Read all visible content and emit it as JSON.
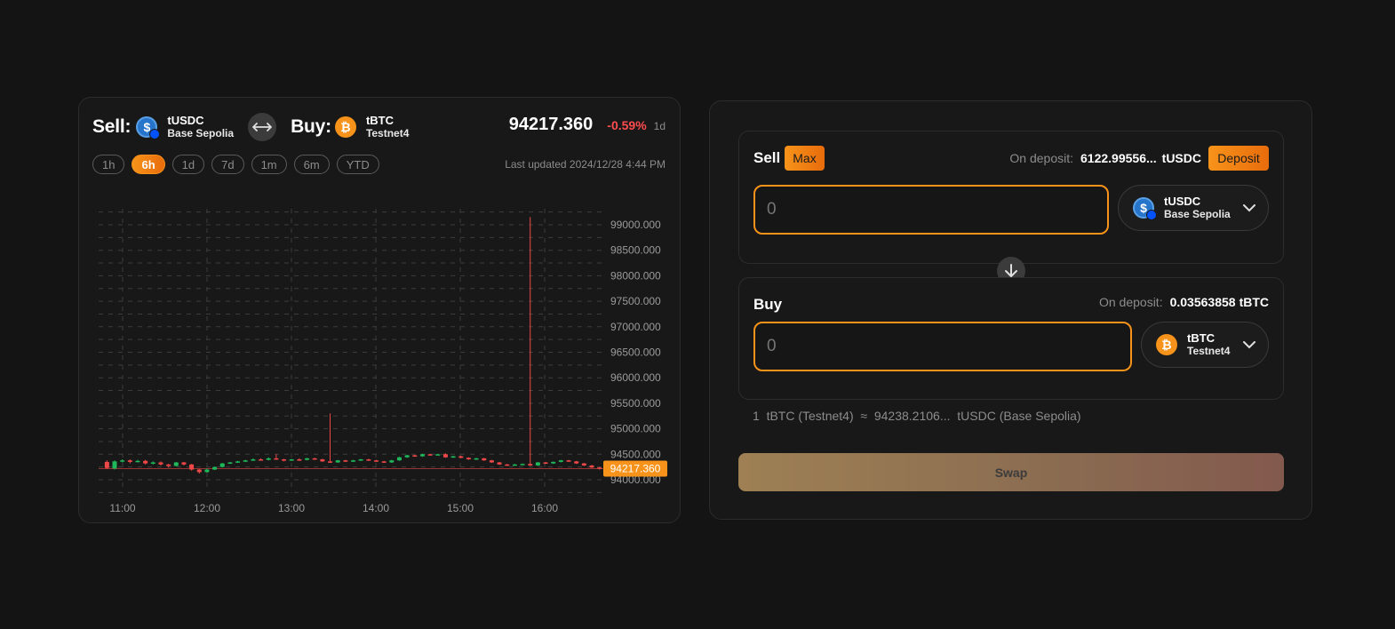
{
  "chart_header": {
    "sell_label": "Sell:",
    "buy_label": "Buy:",
    "sell_token": {
      "symbol": "tUSDC",
      "network": "Base Sepolia"
    },
    "buy_token": {
      "symbol": "tBTC",
      "network": "Testnet4"
    },
    "price": "94217.360",
    "change": "-0.59%",
    "period": "1d",
    "last_updated": "Last updated 2024/12/28 4:44 PM",
    "ranges": [
      "1h",
      "6h",
      "1d",
      "7d",
      "1m",
      "6m",
      "YTD"
    ],
    "active_range": "6h"
  },
  "chart_data": {
    "type": "candlestick",
    "x_ticks": [
      "11:00",
      "12:00",
      "13:00",
      "14:00",
      "15:00",
      "16:00"
    ],
    "y_ticks": [
      "99000.000",
      "98500.000",
      "98000.000",
      "97500.000",
      "97000.000",
      "96500.000",
      "96000.000",
      "95500.000",
      "95000.000",
      "94500.000",
      "94000.000"
    ],
    "ylim": [
      94000,
      99000
    ],
    "current_price_label": "94217.360",
    "current_price": 94217.36,
    "colors": {
      "up": "#1fb85a",
      "down": "#f04848",
      "grid": "#3c3c3c",
      "price_tag": "#f7931a"
    },
    "candles": [
      {
        "o": 94350,
        "c": 94230,
        "h": 94380,
        "l": 94210
      },
      {
        "o": 94220,
        "c": 94360,
        "h": 94380,
        "l": 94200
      },
      {
        "o": 94360,
        "c": 94380,
        "h": 94400,
        "l": 94340
      },
      {
        "o": 94380,
        "c": 94350,
        "h": 94400,
        "l": 94320
      },
      {
        "o": 94350,
        "c": 94370,
        "h": 94390,
        "l": 94340
      },
      {
        "o": 94370,
        "c": 94320,
        "h": 94390,
        "l": 94300
      },
      {
        "o": 94320,
        "c": 94340,
        "h": 94360,
        "l": 94300
      },
      {
        "o": 94340,
        "c": 94300,
        "h": 94360,
        "l": 94280
      },
      {
        "o": 94300,
        "c": 94270,
        "h": 94310,
        "l": 94240
      },
      {
        "o": 94270,
        "c": 94340,
        "h": 94350,
        "l": 94260
      },
      {
        "o": 94340,
        "c": 94300,
        "h": 94350,
        "l": 94280
      },
      {
        "o": 94300,
        "c": 94200,
        "h": 94310,
        "l": 94180
      },
      {
        "o": 94200,
        "c": 94150,
        "h": 94210,
        "l": 94120
      },
      {
        "o": 94150,
        "c": 94200,
        "h": 94220,
        "l": 94140
      },
      {
        "o": 94200,
        "c": 94250,
        "h": 94260,
        "l": 94190
      },
      {
        "o": 94250,
        "c": 94320,
        "h": 94330,
        "l": 94240
      },
      {
        "o": 94320,
        "c": 94340,
        "h": 94350,
        "l": 94310
      },
      {
        "o": 94340,
        "c": 94360,
        "h": 94370,
        "l": 94330
      },
      {
        "o": 94360,
        "c": 94380,
        "h": 94390,
        "l": 94350
      },
      {
        "o": 94380,
        "c": 94400,
        "h": 94420,
        "l": 94370
      },
      {
        "o": 94400,
        "c": 94390,
        "h": 94420,
        "l": 94380
      },
      {
        "o": 94390,
        "c": 94420,
        "h": 94440,
        "l": 94380
      },
      {
        "o": 94420,
        "c": 94400,
        "h": 94500,
        "l": 94390
      },
      {
        "o": 94400,
        "c": 94380,
        "h": 94410,
        "l": 94360
      },
      {
        "o": 94380,
        "c": 94400,
        "h": 94410,
        "l": 94370
      },
      {
        "o": 94400,
        "c": 94390,
        "h": 94420,
        "l": 94370
      },
      {
        "o": 94390,
        "c": 94420,
        "h": 94430,
        "l": 94380
      },
      {
        "o": 94420,
        "c": 94400,
        "h": 94430,
        "l": 94390
      },
      {
        "o": 94400,
        "c": 94360,
        "h": 94410,
        "l": 94350
      },
      {
        "o": 94360,
        "c": 94340,
        "h": 95300,
        "l": 94330
      },
      {
        "o": 94340,
        "c": 94380,
        "h": 94390,
        "l": 94330
      },
      {
        "o": 94380,
        "c": 94360,
        "h": 94390,
        "l": 94350
      },
      {
        "o": 94360,
        "c": 94380,
        "h": 94390,
        "l": 94350
      },
      {
        "o": 94380,
        "c": 94400,
        "h": 94410,
        "l": 94370
      },
      {
        "o": 94400,
        "c": 94380,
        "h": 94410,
        "l": 94370
      },
      {
        "o": 94380,
        "c": 94360,
        "h": 94390,
        "l": 94350
      },
      {
        "o": 94360,
        "c": 94340,
        "h": 94370,
        "l": 94330
      },
      {
        "o": 94340,
        "c": 94380,
        "h": 94390,
        "l": 94330
      },
      {
        "o": 94380,
        "c": 94440,
        "h": 94450,
        "l": 94370
      },
      {
        "o": 94440,
        "c": 94480,
        "h": 94490,
        "l": 94430
      },
      {
        "o": 94480,
        "c": 94460,
        "h": 94490,
        "l": 94450
      },
      {
        "o": 94460,
        "c": 94500,
        "h": 94510,
        "l": 94450
      },
      {
        "o": 94500,
        "c": 94490,
        "h": 94510,
        "l": 94480
      },
      {
        "o": 94490,
        "c": 94500,
        "h": 94510,
        "l": 94480
      },
      {
        "o": 94500,
        "c": 94440,
        "h": 94520,
        "l": 94430
      },
      {
        "o": 94440,
        "c": 94460,
        "h": 94470,
        "l": 94430
      },
      {
        "o": 94460,
        "c": 94430,
        "h": 94470,
        "l": 94420
      },
      {
        "o": 94430,
        "c": 94400,
        "h": 94440,
        "l": 94390
      },
      {
        "o": 94400,
        "c": 94420,
        "h": 94430,
        "l": 94390
      },
      {
        "o": 94420,
        "c": 94380,
        "h": 94430,
        "l": 94370
      },
      {
        "o": 94380,
        "c": 94340,
        "h": 94390,
        "l": 94330
      },
      {
        "o": 94340,
        "c": 94300,
        "h": 94350,
        "l": 94290
      },
      {
        "o": 94300,
        "c": 94280,
        "h": 94310,
        "l": 94270
      },
      {
        "o": 94280,
        "c": 94300,
        "h": 94310,
        "l": 94270
      },
      {
        "o": 94300,
        "c": 94310,
        "h": 94320,
        "l": 94290
      },
      {
        "o": 94310,
        "c": 94280,
        "h": 99150,
        "l": 94270
      },
      {
        "o": 94280,
        "c": 94340,
        "h": 94350,
        "l": 94270
      },
      {
        "o": 94340,
        "c": 94320,
        "h": 94350,
        "l": 94310
      },
      {
        "o": 94320,
        "c": 94350,
        "h": 94360,
        "l": 94310
      },
      {
        "o": 94350,
        "c": 94380,
        "h": 94390,
        "l": 94340
      },
      {
        "o": 94380,
        "c": 94360,
        "h": 94390,
        "l": 94350
      },
      {
        "o": 94360,
        "c": 94320,
        "h": 94370,
        "l": 94310
      },
      {
        "o": 94320,
        "c": 94280,
        "h": 94330,
        "l": 94270
      },
      {
        "o": 94280,
        "c": 94240,
        "h": 94290,
        "l": 94230
      },
      {
        "o": 94240,
        "c": 94217,
        "h": 94250,
        "l": 94200
      }
    ]
  },
  "swap": {
    "sell": {
      "title": "Sell",
      "max_label": "Max",
      "deposit_label": "On deposit:",
      "deposit_value": "6122.99556...",
      "deposit_unit": "tUSDC",
      "deposit_button": "Deposit",
      "amount_placeholder": "0",
      "token": {
        "symbol": "tUSDC",
        "network": "Base Sepolia"
      }
    },
    "buy": {
      "title": "Buy",
      "deposit_label": "On deposit:",
      "deposit_value": "0.03563858",
      "deposit_unit": "tBTC",
      "amount_placeholder": "0",
      "token": {
        "symbol": "tBTC",
        "network": "Testnet4"
      }
    },
    "rate": {
      "left_amount": "1",
      "left_token": "tBTC (Testnet4)",
      "approx": "≈",
      "right_amount": "94238.2106...",
      "right_token": "tUSDC (Base Sepolia)"
    },
    "swap_button": "Swap"
  }
}
